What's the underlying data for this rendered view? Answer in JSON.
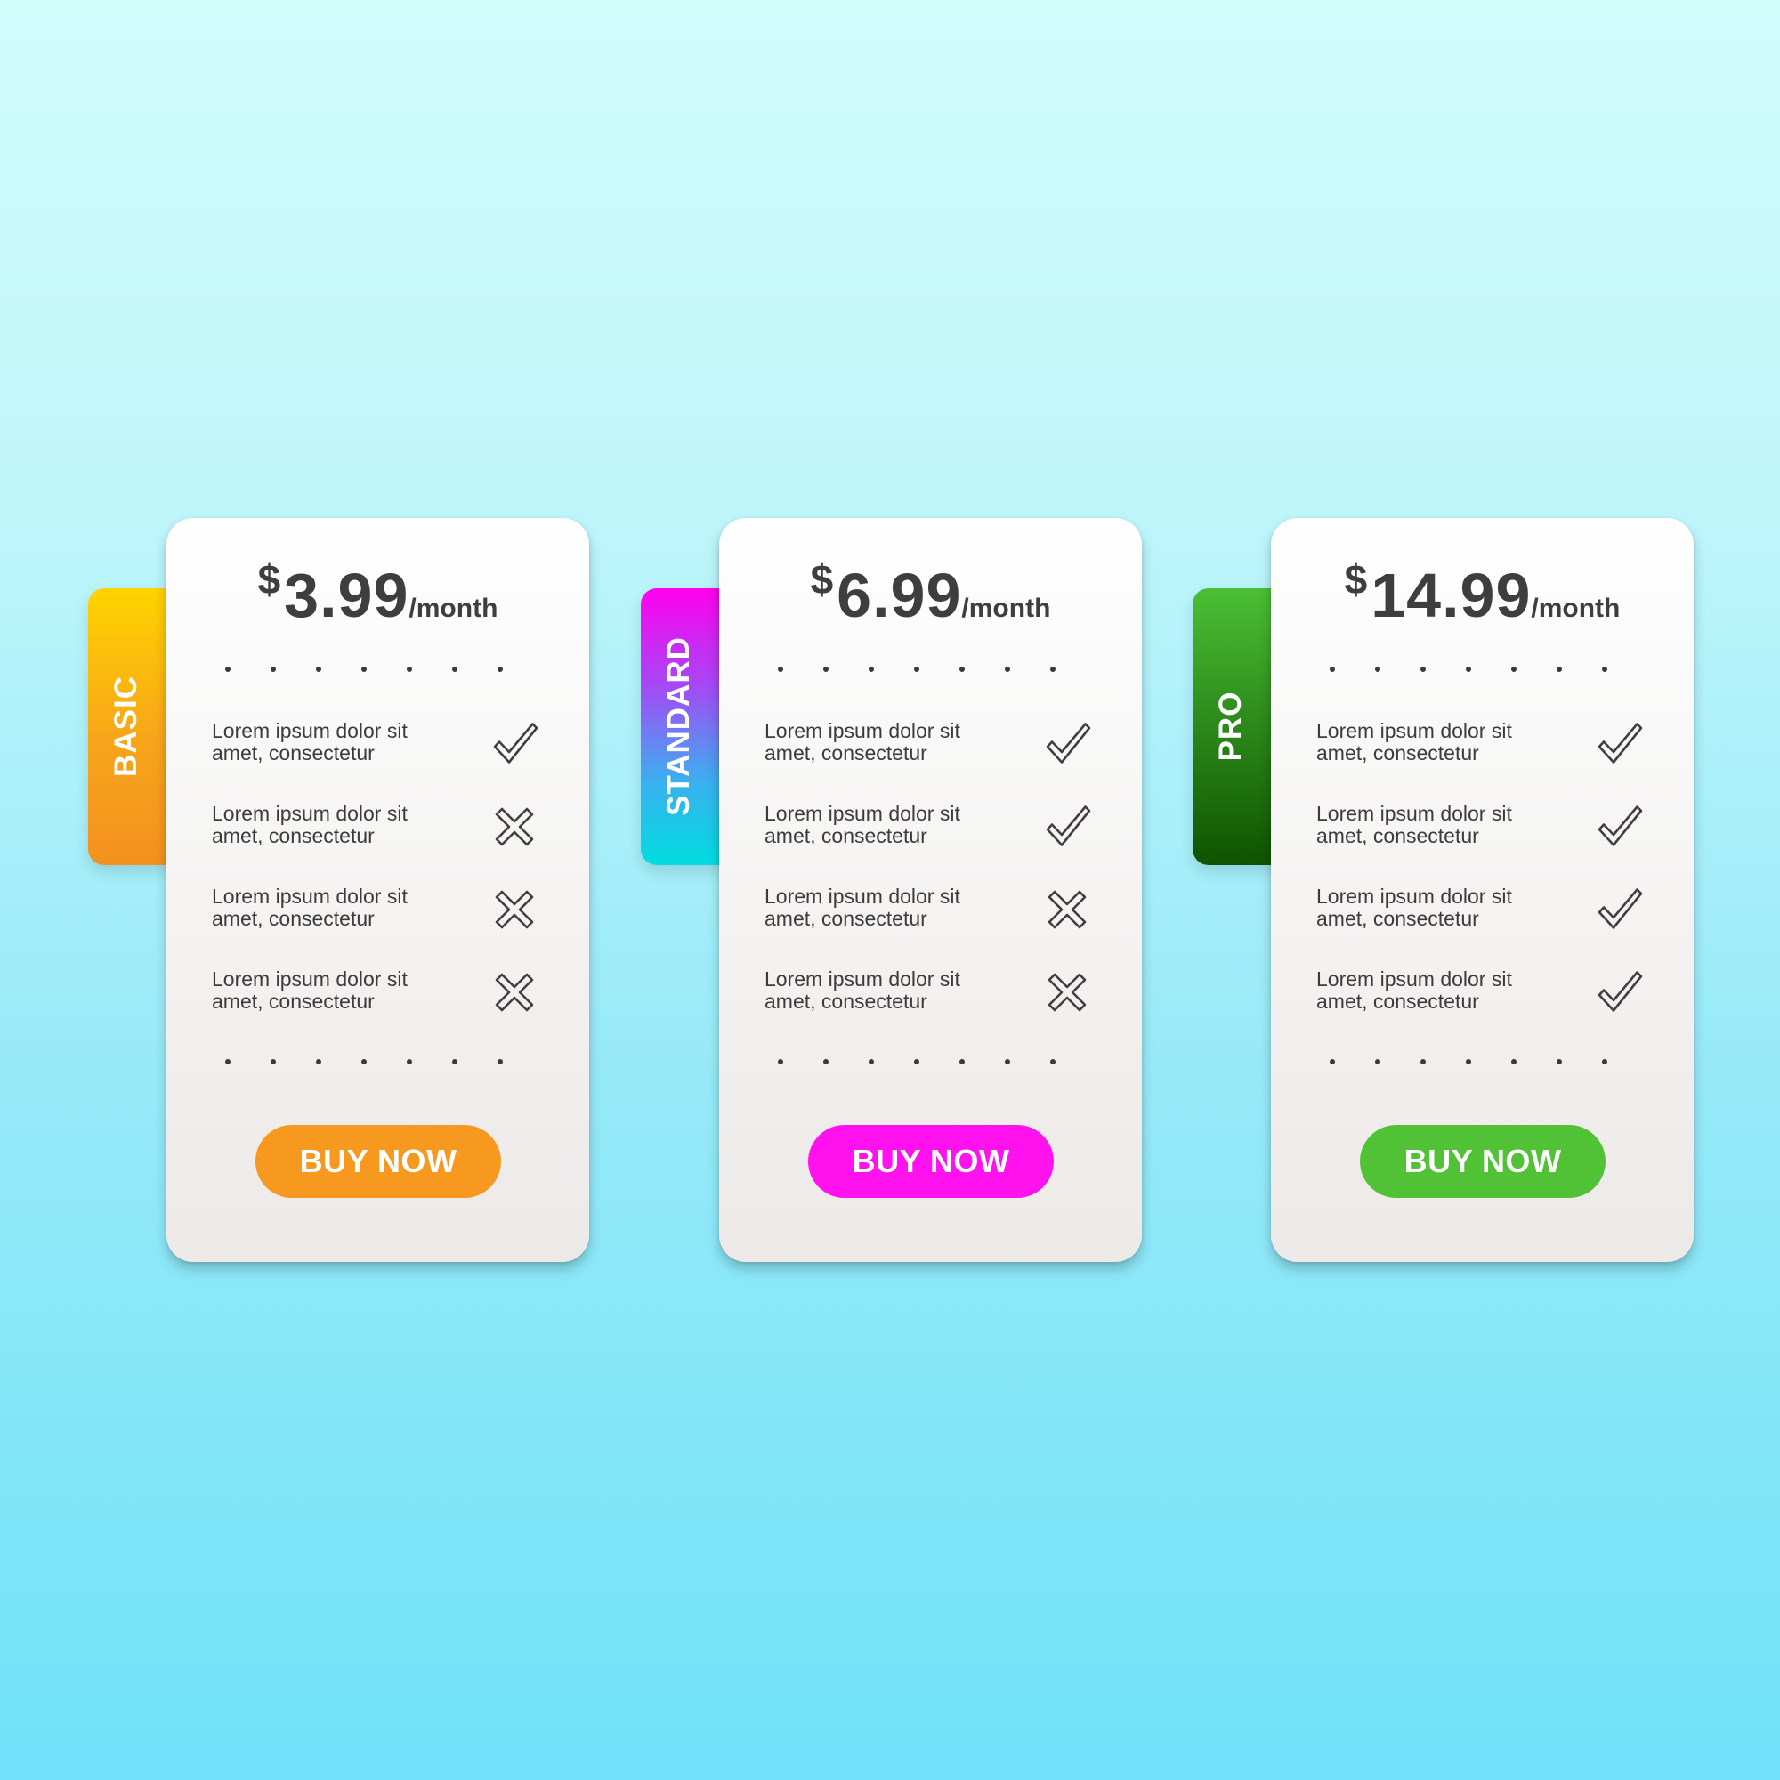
{
  "plans": [
    {
      "name": "BASIC",
      "currency": "$",
      "amount": "3.99",
      "period": "/month",
      "features": [
        {
          "line1": "Lorem ipsum dolor sit",
          "line2": "amet, consectetur",
          "icon": "check-icon"
        },
        {
          "line1": "Lorem ipsum dolor sit",
          "line2": "amet, consectetur",
          "icon": "cross-icon"
        },
        {
          "line1": "Lorem ipsum dolor sit",
          "line2": "amet, consectetur",
          "icon": "cross-icon"
        },
        {
          "line1": "Lorem ipsum dolor sit",
          "line2": "amet, consectetur",
          "icon": "cross-icon"
        }
      ],
      "button_label": "BUY NOW",
      "accent_color": "#f7991e"
    },
    {
      "name": "STANDARD",
      "currency": "$",
      "amount": "6.99",
      "period": "/month",
      "features": [
        {
          "line1": "Lorem ipsum dolor sit",
          "line2": "amet, consectetur",
          "icon": "check-icon"
        },
        {
          "line1": "Lorem ipsum dolor sit",
          "line2": "amet, consectetur",
          "icon": "check-icon"
        },
        {
          "line1": "Lorem ipsum dolor sit",
          "line2": "amet, consectetur",
          "icon": "cross-icon"
        },
        {
          "line1": "Lorem ipsum dolor sit",
          "line2": "amet, consectetur",
          "icon": "cross-icon"
        }
      ],
      "button_label": "BUY NOW",
      "accent_color": "#ff12ee"
    },
    {
      "name": "PRO",
      "currency": "$",
      "amount": "14.99",
      "period": "/month",
      "features": [
        {
          "line1": "Lorem ipsum dolor sit",
          "line2": "amet, consectetur",
          "icon": "check-icon"
        },
        {
          "line1": "Lorem ipsum dolor sit",
          "line2": "amet, consectetur",
          "icon": "check-icon"
        },
        {
          "line1": "Lorem ipsum dolor sit",
          "line2": "amet, consectetur",
          "icon": "check-icon"
        },
        {
          "line1": "Lorem ipsum dolor sit",
          "line2": "amet, consectetur",
          "icon": "check-icon"
        }
      ],
      "button_label": "BUY NOW",
      "accent_color": "#51c135"
    }
  ]
}
